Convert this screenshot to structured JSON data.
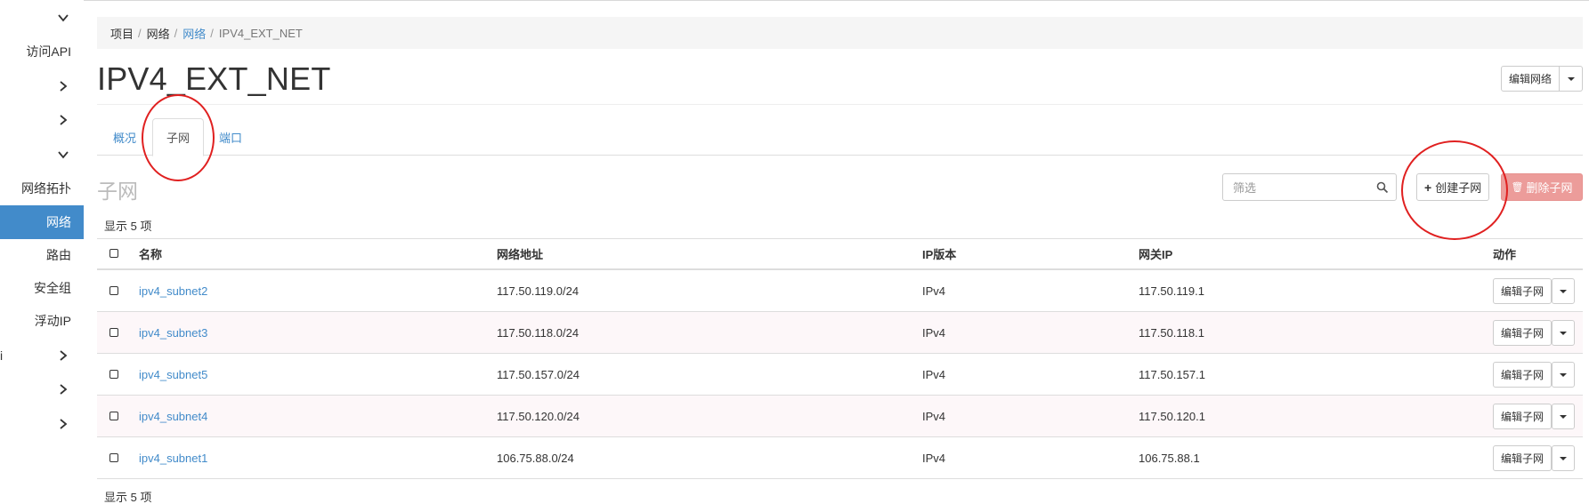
{
  "sidebar": {
    "items": [
      {
        "label": "访问API"
      },
      {
        "label": "网络拓扑"
      },
      {
        "label": "网络"
      },
      {
        "label": "路由"
      },
      {
        "label": "安全组"
      },
      {
        "label": "浮动IP"
      }
    ],
    "partial_label": "i"
  },
  "breadcrumb": [
    "项目",
    "网络",
    "网络",
    "IPV4_EXT_NET"
  ],
  "page": {
    "title": "IPV4_EXT_NET",
    "edit_network_label": "编辑网络"
  },
  "tabs": [
    "概况",
    "子网",
    "端口"
  ],
  "section": {
    "title": "子网",
    "filter_placeholder": "筛选",
    "create_label": "创建子网",
    "create_icon": "plus-icon",
    "delete_label": "删除子网",
    "delete_icon": "trash-icon",
    "count_top": "显示 5 项",
    "count_bottom": "显示 5 项"
  },
  "table": {
    "columns": [
      "名称",
      "网络地址",
      "IP版本",
      "网关IP",
      "动作"
    ],
    "rows": [
      {
        "name": "ipv4_subnet2",
        "address": "117.50.119.0/24",
        "ip_version": "IPv4",
        "gateway": "117.50.119.1",
        "action": "编辑子网"
      },
      {
        "name": "ipv4_subnet3",
        "address": "117.50.118.0/24",
        "ip_version": "IPv4",
        "gateway": "117.50.118.1",
        "action": "编辑子网"
      },
      {
        "name": "ipv4_subnet5",
        "address": "117.50.157.0/24",
        "ip_version": "IPv4",
        "gateway": "117.50.157.1",
        "action": "编辑子网"
      },
      {
        "name": "ipv4_subnet4",
        "address": "117.50.120.0/24",
        "ip_version": "IPv4",
        "gateway": "117.50.120.1",
        "action": "编辑子网"
      },
      {
        "name": "ipv4_subnet1",
        "address": "106.75.88.0/24",
        "ip_version": "IPv4",
        "gateway": "106.75.88.1",
        "action": "编辑子网"
      }
    ]
  },
  "colors": {
    "accent": "#428bca",
    "danger_button": "#ec9c9a",
    "annotation": "#e02020"
  }
}
